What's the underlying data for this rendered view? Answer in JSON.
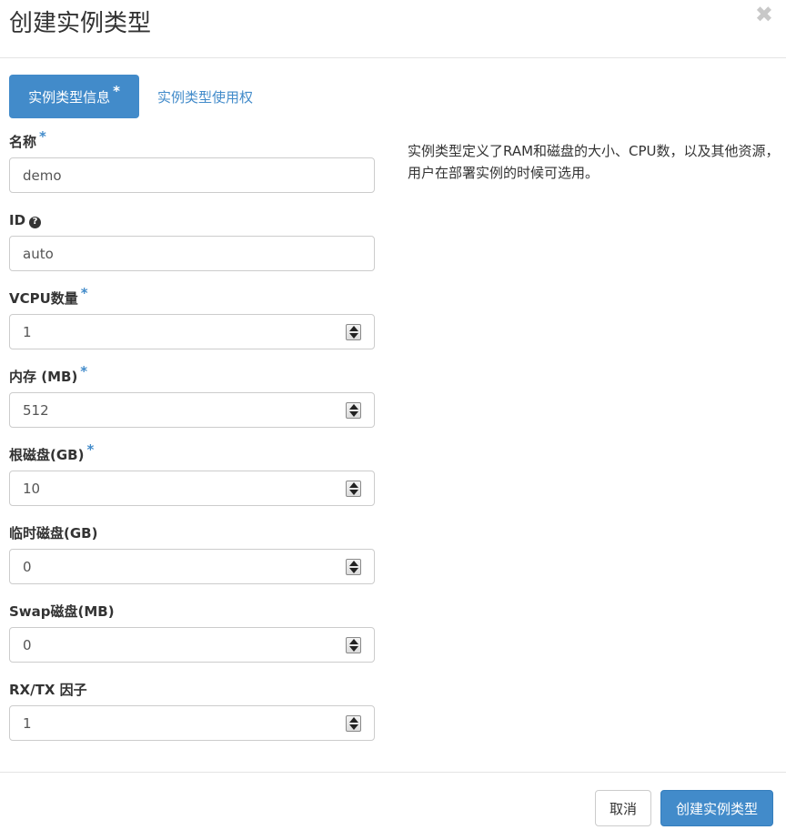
{
  "modal": {
    "title": "创建实例类型",
    "close_glyph": "✖"
  },
  "tabs": [
    {
      "label": "实例类型信息",
      "required_mark": "*"
    },
    {
      "label": "实例类型使用权"
    }
  ],
  "fields": [
    {
      "label": "名称",
      "required_mark": "*",
      "value": "demo"
    },
    {
      "label": "ID",
      "help_icon": "?",
      "value": "auto"
    },
    {
      "label": "VCPU数量",
      "required_mark": "*",
      "value": "1"
    },
    {
      "label": "内存 (MB)",
      "required_mark": "*",
      "value": "512"
    },
    {
      "label": "根磁盘(GB)",
      "required_mark": "*",
      "value": "10"
    },
    {
      "label": "临时磁盘(GB)",
      "value": "0"
    },
    {
      "label": "Swap磁盘(MB)",
      "value": "0"
    },
    {
      "label": "RX/TX 因子",
      "value": "1"
    }
  ],
  "description": "实例类型定义了RAM和磁盘的大小、CPU数，以及其他资源，用户在部署实例的时候可选用。",
  "footer": {
    "cancel_label": "取消",
    "submit_label": "创建实例类型"
  },
  "colors": {
    "accent": "#428bca",
    "border": "#cccccc"
  }
}
